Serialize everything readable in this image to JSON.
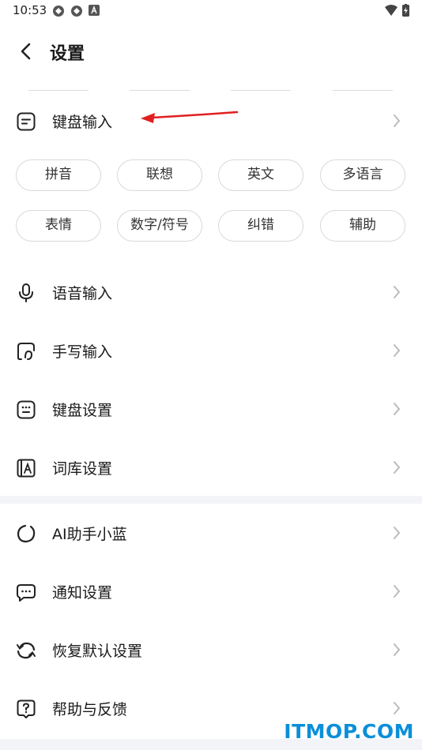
{
  "status": {
    "time": "10:53"
  },
  "header": {
    "title": "设置"
  },
  "keyboard_input": {
    "label": "键盘输入",
    "chips": [
      "拼音",
      "联想",
      "英文",
      "多语言",
      "表情",
      "数字/符号",
      "纠错",
      "辅助"
    ]
  },
  "section1": [
    {
      "label": "语音输入",
      "icon": "microphone-icon"
    },
    {
      "label": "手写输入",
      "icon": "handwriting-icon"
    },
    {
      "label": "键盘设置",
      "icon": "keyboard-icon"
    },
    {
      "label": "词库设置",
      "icon": "dictionary-icon"
    }
  ],
  "section2": [
    {
      "label": "AI助手小蓝",
      "icon": "ai-assistant-icon"
    },
    {
      "label": "通知设置",
      "icon": "notification-icon"
    },
    {
      "label": "恢复默认设置",
      "icon": "restore-icon"
    },
    {
      "label": "帮助与反馈",
      "icon": "help-icon"
    }
  ],
  "watermark": "ITMOP.COM",
  "colors": {
    "accent_arrow": "#e02020",
    "watermark": "#0b8fd9",
    "divider": "#f3f4f7"
  }
}
